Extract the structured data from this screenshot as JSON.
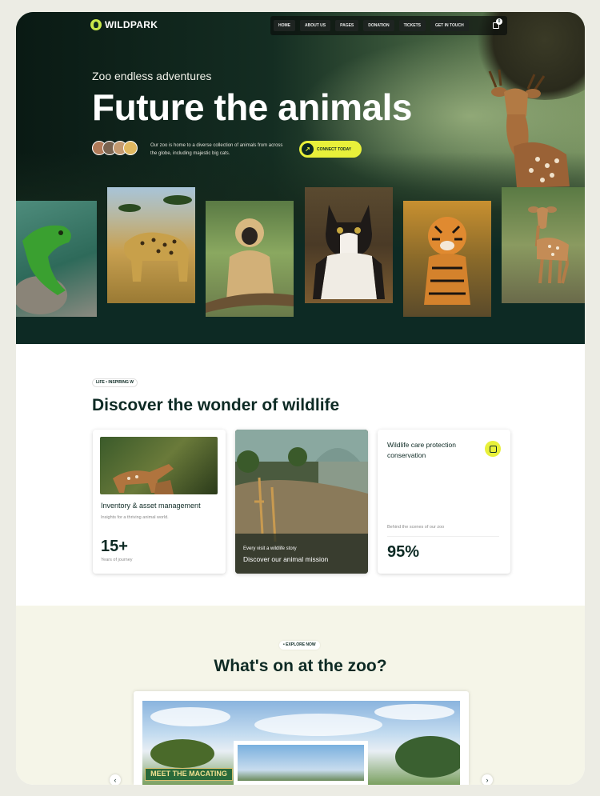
{
  "brand": {
    "name": "WILDPARK"
  },
  "nav": {
    "items": [
      "HOME",
      "ABOUT US",
      "PAGES",
      "DONATION",
      "TICKETS",
      "GET IN TOUCH"
    ],
    "cart_count": "0"
  },
  "hero": {
    "tagline": "Zoo endless adventures",
    "title": "Future the animals",
    "description": "Our zoo is home to a diverse collection of animals from across the globe, including majestic big cats.",
    "cta_label": "CONNECT TODAY"
  },
  "discover": {
    "breadcrumb": "LIFE • INSPIRING W",
    "title": "Discover the wonder of wildlife",
    "card1": {
      "title": "Inventory & asset management",
      "subtitle": "Insights for a thriving animal world.",
      "stat": "15+",
      "stat_label": "Years of journey"
    },
    "card2": {
      "small": "Every visit a wildlife story",
      "title": "Discover our animal mission"
    },
    "card3": {
      "title": "Wildlife care protection conservation",
      "subtitle": "Behind the scenes of our zoo",
      "stat": "95%"
    }
  },
  "whats_on": {
    "pill": "• EXPLORE NOW",
    "title": "What's on at the zoo?",
    "banner": "MEET THE MACATING"
  },
  "colors": {
    "dark": "#0d2a24",
    "accent": "#e8f03a",
    "cream": "#f5f5e8"
  },
  "icons": [
    "logo-icon",
    "cart-icon",
    "arrow-up-right-icon",
    "chevron-left-icon",
    "chevron-right-icon",
    "shield-icon"
  ]
}
